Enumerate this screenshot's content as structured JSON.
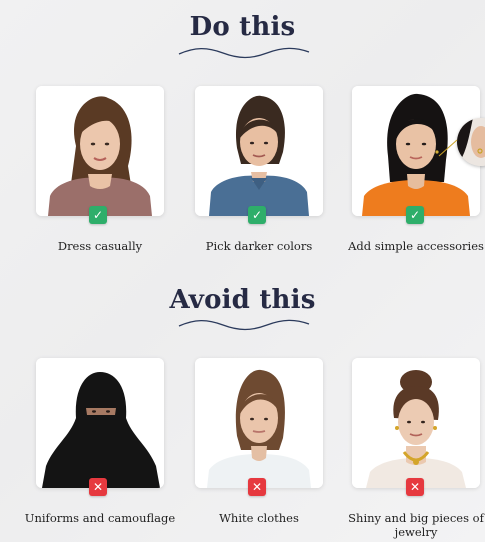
{
  "do_section": {
    "title": "Do this",
    "items": [
      {
        "caption": "Dress casually",
        "badge": "check-icon"
      },
      {
        "caption": "Pick darker colors",
        "badge": "check-icon"
      },
      {
        "caption": "Add simple accessories",
        "badge": "check-icon"
      }
    ]
  },
  "avoid_section": {
    "title": "Avoid this",
    "items": [
      {
        "caption": "Uniforms and camouflage",
        "badge": "x-icon"
      },
      {
        "caption": "White clothes",
        "badge": "x-icon"
      },
      {
        "caption": "Shiny and big pieces of jewelry",
        "badge": "x-icon"
      }
    ]
  },
  "colors": {
    "title": "#262a44",
    "ok_badge": "#2eae6a",
    "bad_badge": "#e6393f"
  }
}
